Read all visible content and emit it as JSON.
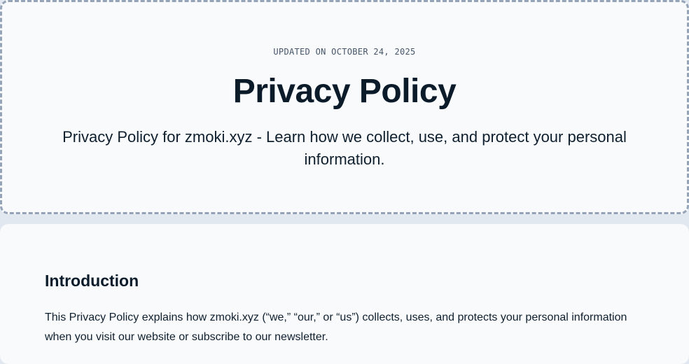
{
  "header": {
    "updated": "UPDATED ON OCTOBER 24, 2025",
    "title": "Privacy Policy",
    "subtitle": "Privacy Policy for zmoki.xyz - Learn how we collect, use, and protect your personal information."
  },
  "sections": [
    {
      "heading": "Introduction",
      "body": "This Privacy Policy explains how zmoki.xyz (“we,” “our,” or “us”) collects, uses, and protects your personal information when you visit our website or subscribe to our newsletter."
    }
  ]
}
